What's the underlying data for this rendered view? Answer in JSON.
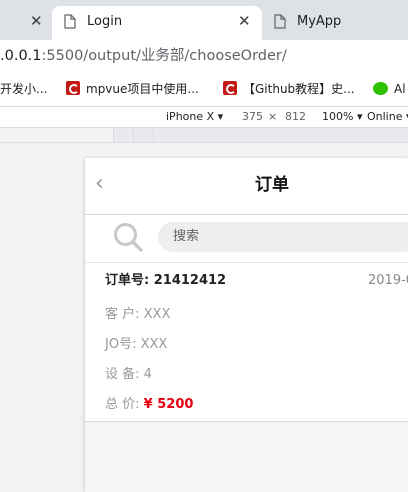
{
  "browser": {
    "tabs": [
      {
        "title": "Login",
        "close": "✕"
      },
      {
        "title": "MyApp"
      }
    ],
    "left_close": "✕",
    "url": {
      "host": ".0.0.1",
      "rest": ":5500/output/业务部/chooseOrder/"
    },
    "bookmarks": [
      {
        "label": "开发小..."
      },
      {
        "label": "mpvue项目中使用..."
      },
      {
        "label": "【Github教程】史..."
      },
      {
        "label": "Al"
      }
    ]
  },
  "devtools": {
    "device": "iPhone X",
    "width": "375",
    "times": "×",
    "height": "812",
    "zoom": "100%",
    "network": "Online"
  },
  "app": {
    "back_glyph": "‹",
    "title": "订单",
    "search_placeholder": "搜索",
    "order": {
      "number_label": "订单号:",
      "number_value": "21412412",
      "date": "2019-0",
      "customer": "客 户: XXX",
      "jo": "JO号: XXX",
      "equipment": "设 备: 4",
      "total_label": "总 价: ",
      "total_value": "¥ 5200"
    }
  },
  "colors": {
    "price": "#e60012",
    "tab_active": "#ffffff",
    "tab_strip": "#dee1e6"
  }
}
